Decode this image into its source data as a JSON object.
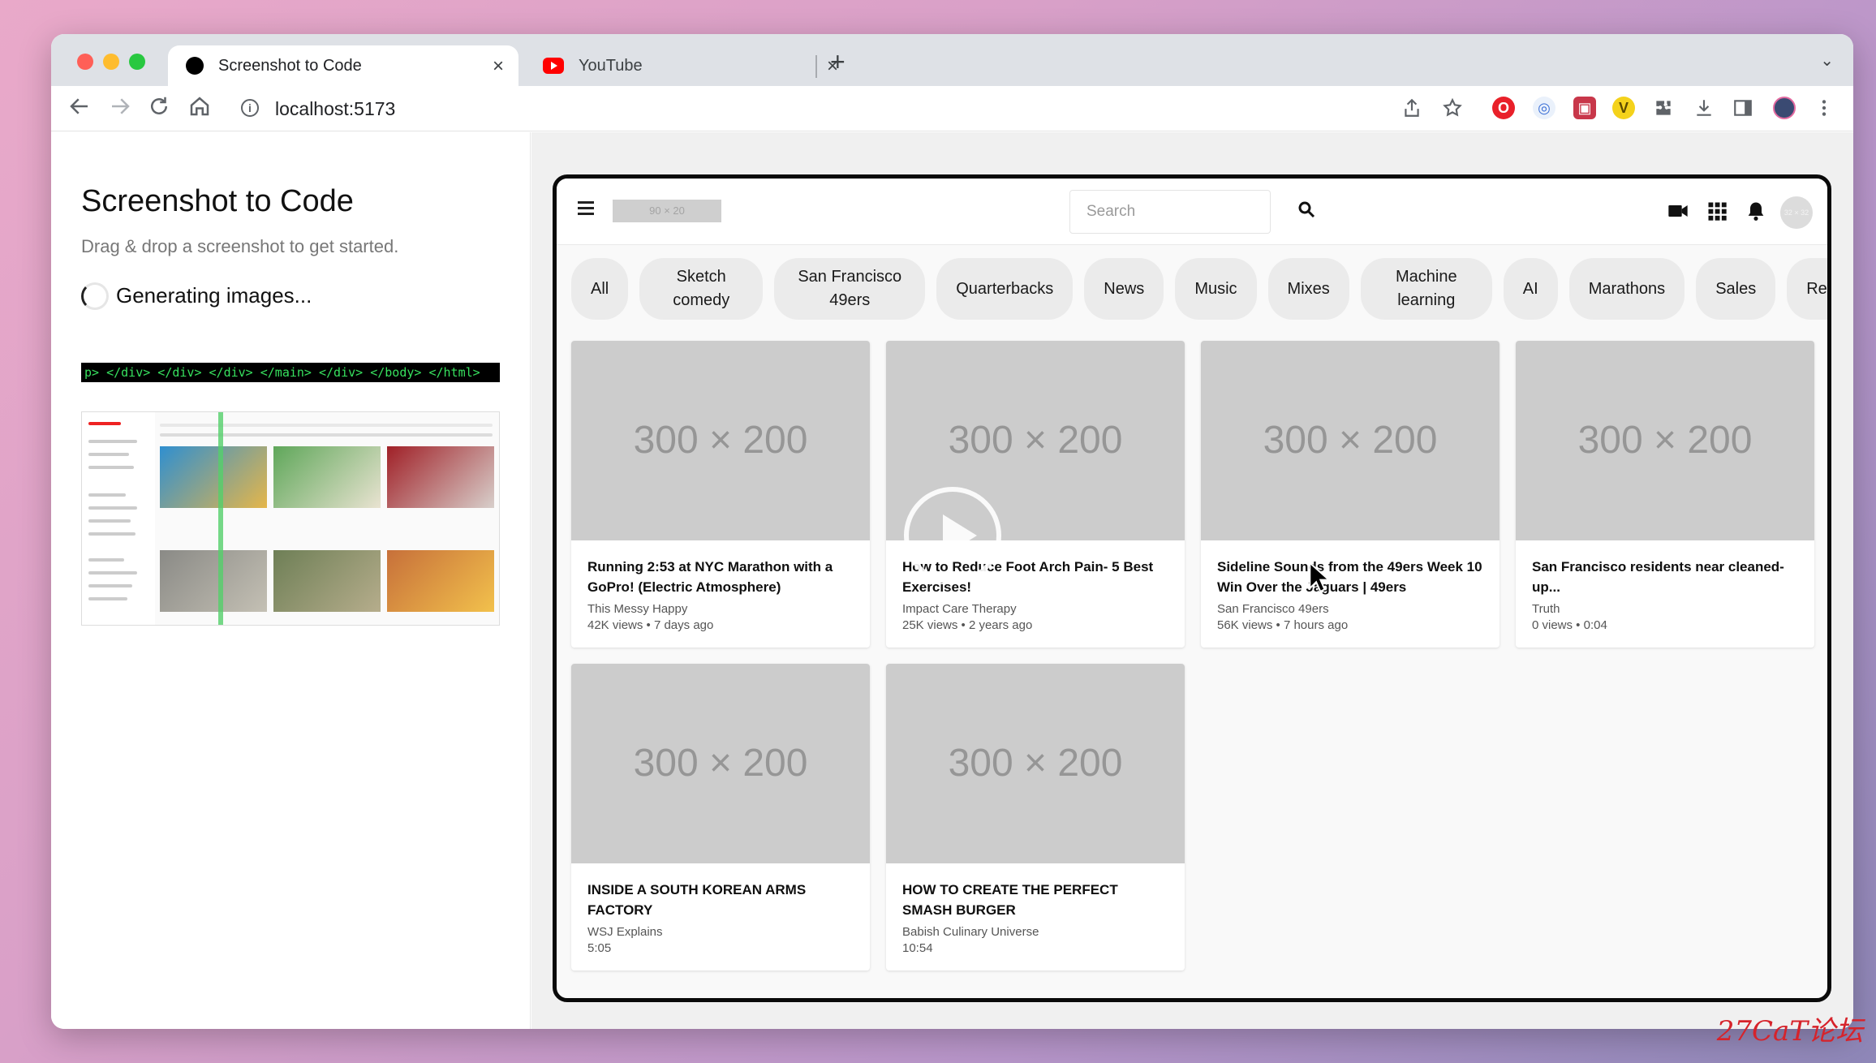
{
  "browser": {
    "tabs": [
      {
        "title": "Screenshot to Code",
        "active": true,
        "favicon": "black-dot-icon"
      },
      {
        "title": "YouTube",
        "active": false,
        "favicon": "youtube-icon"
      }
    ],
    "close_glyph": "×",
    "new_tab_glyph": "+",
    "tab_menu_glyph": "⌄",
    "address": "localhost:5173",
    "info_glyph": "i"
  },
  "app": {
    "title": "Screenshot to Code",
    "subtitle": "Drag & drop a screenshot to get started.",
    "status": "Generating images...",
    "code_preview": "p> </div> </div> </div> </main> </div> </body> </html>"
  },
  "preview": {
    "logo_placeholder": "90 × 20",
    "search_placeholder": "Search",
    "avatar_placeholder": "32 × 32",
    "chips": [
      "All",
      "Sketch comedy",
      "San Francisco 49ers",
      "Quarterbacks",
      "News",
      "Music",
      "Mixes",
      "Machine learning",
      "AI",
      "Marathons",
      "Sales",
      "Resolutions"
    ],
    "videos": [
      {
        "thumb": "300 × 200",
        "title": "Running 2:53 at NYC Marathon with a GoPro! (Electric Atmosphere)",
        "channel": "This Messy Happy",
        "meta": "42K views • 7 days ago"
      },
      {
        "thumb": "300 × 200",
        "title": "How to Reduce Foot Arch Pain- 5 Best Exercises!",
        "channel": "Impact Care Therapy",
        "meta": "25K views • 2 years ago"
      },
      {
        "thumb": "300 × 200",
        "title": "Sideline Sounds from the 49ers Week 10 Win Over the Jaguars | 49ers",
        "channel": "San Francisco 49ers",
        "meta": "56K views • 7 hours ago"
      },
      {
        "thumb": "300 × 200",
        "title": "San Francisco residents near cleaned-up...",
        "channel": "Truth",
        "meta": "0 views • 0:04"
      },
      {
        "thumb": "300 × 200",
        "title": "INSIDE A SOUTH KOREAN ARMS FACTORY",
        "channel": "WSJ Explains",
        "meta": "5:05"
      },
      {
        "thumb": "300 × 200",
        "title": "HOW TO CREATE THE PERFECT SMASH BURGER",
        "channel": "Babish Culinary Universe",
        "meta": "10:54"
      }
    ]
  },
  "watermark": "27CaT论坛",
  "colors": {
    "accent_red": "#ff5f57",
    "accent_yellow": "#febc2e",
    "accent_green": "#28c840",
    "code_green": "#37e05e",
    "youtube_red": "#ff0000"
  }
}
